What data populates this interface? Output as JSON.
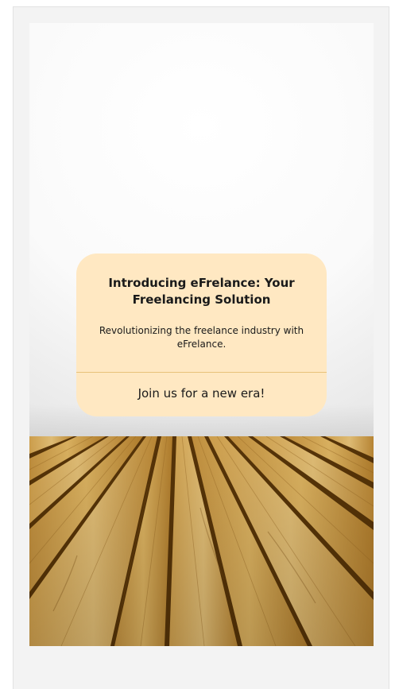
{
  "card": {
    "title": "Introducing eFrelance: Your Freelancing Solution",
    "subtitle": "Revolutionizing the freelance industry with eFrelance.",
    "cta": "Join us for a new era!"
  },
  "colors": {
    "card_background": "#ffe8c2",
    "card_divider": "#e8c27a",
    "text": "#1a1a1a",
    "wood_light": "#e0b45c",
    "wood_dark": "#8a5a16"
  },
  "icons": {
    "background": "wooden-deck-image"
  }
}
